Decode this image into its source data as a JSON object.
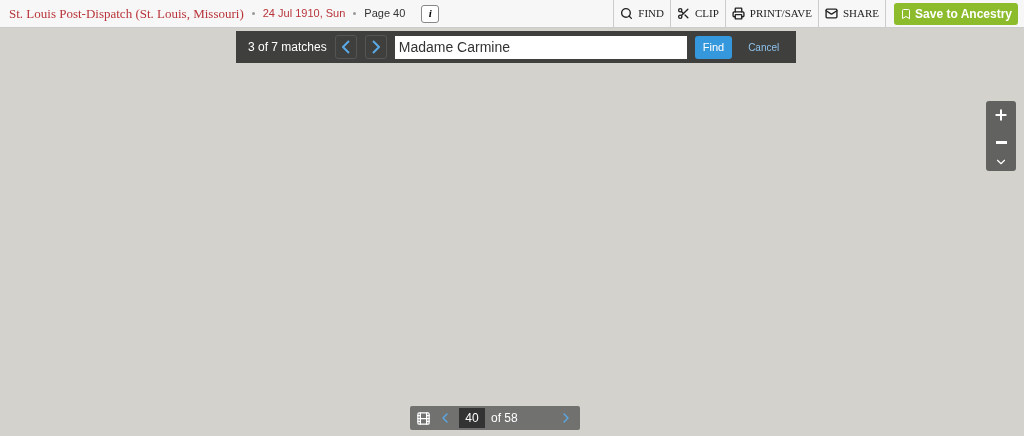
{
  "header": {
    "publication": "St. Louis Post-Dispatch (St. Louis, Missouri)",
    "date": "24 Jul 1910, Sun",
    "page": "Page 40",
    "info": "i"
  },
  "tools": [
    {
      "label": "FIND",
      "kind": "find"
    },
    {
      "label": "CLIP",
      "kind": "clip"
    },
    {
      "label": "PRINT/SAVE",
      "kind": "print"
    },
    {
      "label": "SHARE",
      "kind": "share"
    }
  ],
  "save_button": "Save to Ancestry",
  "find_bar": {
    "match_count": "3 of 7 matches",
    "query": "Madame Carmine",
    "find_button": "Find",
    "cancel": "Cancel"
  },
  "page_nav": {
    "page": "40",
    "total": "of 58"
  }
}
